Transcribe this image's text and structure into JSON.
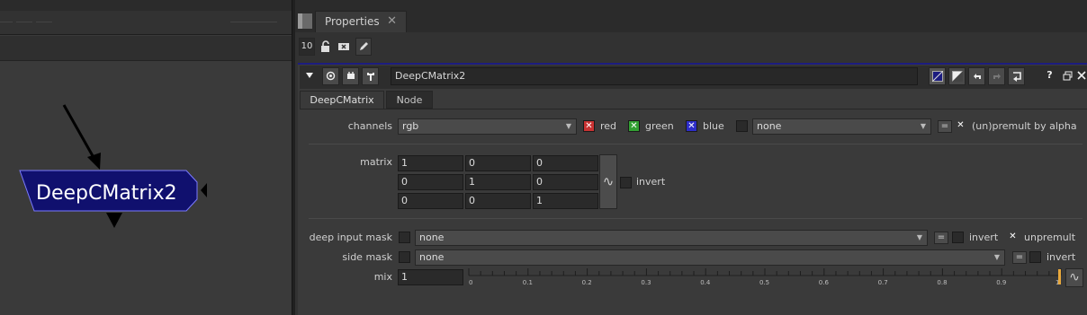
{
  "node_graph": {
    "node_label": "DeepCMatrix2",
    "node_color": "#10106e",
    "node_border": "#7a7aff"
  },
  "properties": {
    "tab_label": "Properties",
    "tab_close": "✕",
    "max_panels": "10",
    "node_name": "DeepCMatrix2",
    "subtabs": [
      "DeepCMatrix",
      "Node"
    ],
    "help": "?",
    "channels": {
      "label": "channels",
      "value": "rgb",
      "red": "red",
      "green": "green",
      "blue": "blue",
      "fourth": "none",
      "premult": "(un)premult by alpha",
      "eq": "="
    },
    "matrix": {
      "label": "matrix",
      "rows": [
        [
          "1",
          "0",
          "0"
        ],
        [
          "0",
          "1",
          "0"
        ],
        [
          "0",
          "0",
          "1"
        ]
      ],
      "invert": "invert"
    },
    "deep_input_mask": {
      "label": "deep input mask",
      "value": "none",
      "invert": "invert",
      "unpremult": "unpremult"
    },
    "side_mask": {
      "label": "side mask",
      "value": "none",
      "invert": "invert"
    },
    "mix": {
      "label": "mix",
      "value": "1",
      "ticks": [
        "0",
        "0.1",
        "0.2",
        "0.3",
        "0.4",
        "0.5",
        "0.6",
        "0.7",
        "0.8",
        "0.9",
        "1"
      ],
      "level": 1
    }
  },
  "colors": {
    "red_check": "#c83232",
    "green_check": "#32a032",
    "blue_check": "#2d2dc8",
    "accent": "#1c1c80"
  }
}
